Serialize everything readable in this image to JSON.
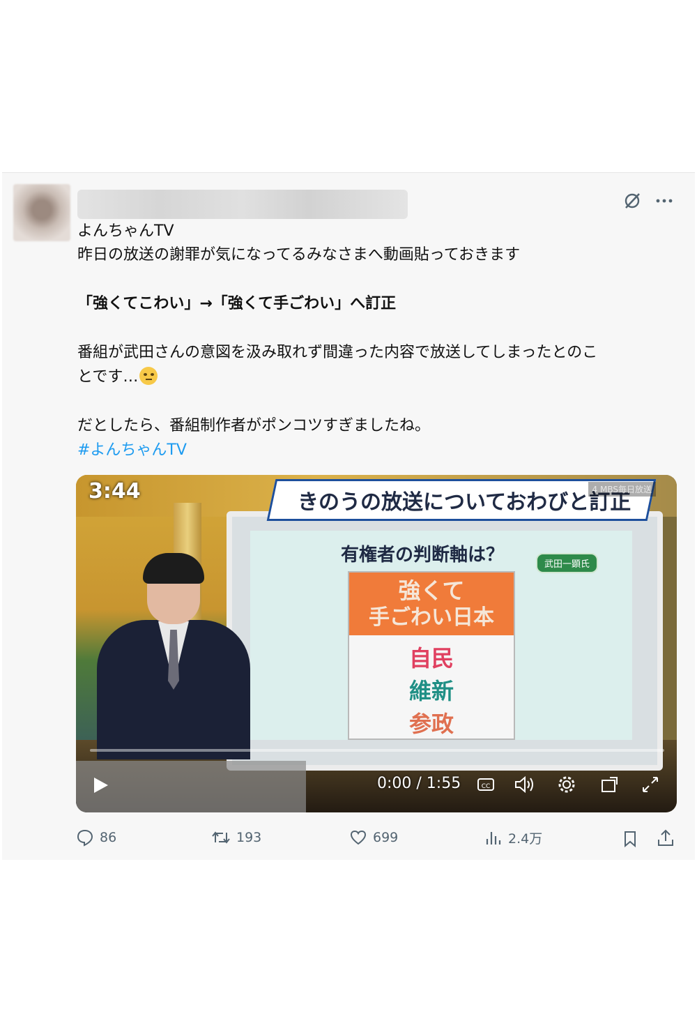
{
  "post": {
    "display_name": "よんちゃんTV",
    "lines": [
      "昨日の放送の謝罪が気になってるみなさまへ動画貼っておきます",
      "「強くてこわい」→「強くて手ごわい」へ訂正",
      "番組が武田さんの意図を汲み取れず間違った内容で放送してしまったとのこ",
      "とです…",
      "だとしたら、番組制作者がポンコツすぎましたね。"
    ],
    "hashtag": "#よんちゃんTV"
  },
  "video": {
    "clock": "3:44",
    "channel_logo": "4 MBS毎日放送",
    "headline": "きのうの放送についておわびと訂正",
    "question": "有権者の判断軸は？",
    "speaker_tag": "武田一顕氏",
    "board_line1": "強くて",
    "board_line2": "手ごわい日本",
    "parties": [
      "自民",
      "維新",
      "参政"
    ],
    "time_display": "0:00 / 1:55",
    "progress": 0
  },
  "actions": {
    "replies": "86",
    "reposts": "193",
    "likes": "699",
    "views": "2.4万"
  },
  "icons": [
    "grok-icon",
    "more-icon",
    "play-icon",
    "cc-icon",
    "volume-icon",
    "settings-icon",
    "pip-icon",
    "fullscreen-icon",
    "reply-icon",
    "repost-icon",
    "like-icon",
    "views-icon",
    "bookmark-icon",
    "share-icon"
  ],
  "colors": {
    "hashtag": "#1d9bf0",
    "action_text": "#536471"
  }
}
